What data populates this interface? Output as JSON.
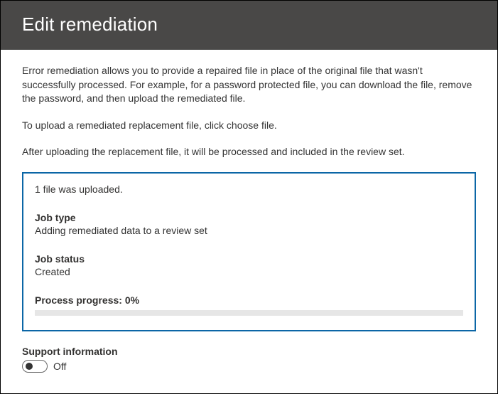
{
  "header": {
    "title": "Edit remediation"
  },
  "intro": {
    "p1": "Error remediation allows you to provide a repaired file in place of the original file that wasn't successfully processed. For example, for a password protected file, you can download the file, remove the password, and then upload the remediated file.",
    "p2": "To upload a remediated replacement file, click choose file.",
    "p3": "After uploading the replacement file, it will be processed and included in the review set."
  },
  "job": {
    "uploaded_msg": "1 file was uploaded.",
    "type_label": "Job type",
    "type_value": "Adding remediated data to a review set",
    "status_label": "Job status",
    "status_value": "Created",
    "progress_label": "Process progress: ",
    "progress_pct_text": "0%",
    "progress_pct": 0
  },
  "support": {
    "label": "Support information",
    "state": "Off",
    "on": false
  }
}
